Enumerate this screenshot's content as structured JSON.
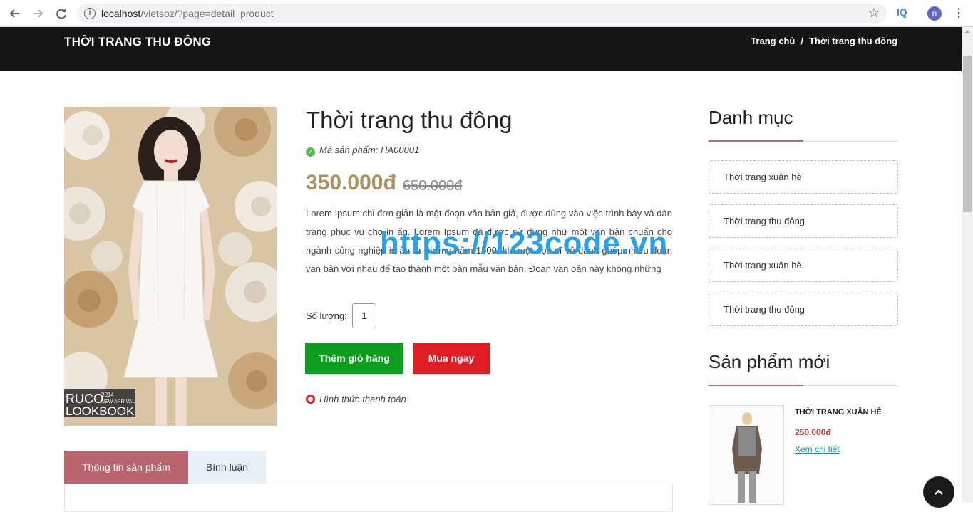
{
  "browser": {
    "url_host": "localhost",
    "url_path": "/vietsoz/?page=detail_product",
    "extension_label": "IQ",
    "profile_initial": "n"
  },
  "header": {
    "title": "THỜI TRANG THU ĐÔNG",
    "breadcrumb": [
      "Trang chủ",
      "/",
      "Thời trang thu đông"
    ]
  },
  "product": {
    "image_badge_line1": "RUCO",
    "image_badge_year": "2014",
    "image_badge_sub": "NEW ARRIVAL",
    "image_badge_line2": "LOOKBOOK",
    "title": "Thời trang thu đông",
    "sku": "Mã sản phẩm: HA00001",
    "price": "350.000đ",
    "old_price": "650.000đ",
    "description": "Lorem Ipsum chỉ đơn giản là một đoạn văn bản giả, được dùng vào việc trình bày và dàn trang phục vụ cho in ấn. Lorem Ipsum đã được sử dụng như một văn bản chuẩn cho ngành công nghiệp in ấn từ những năm 1500, khi một họa sĩ vô danh ghép nhiều đoạn văn bản với nhau để tạo thành một bản mẫu văn bản. Đoạn văn bản này không những",
    "quantity_label": "Số lượng:",
    "quantity_value": "1",
    "add_to_cart": "Thêm giỏ hàng",
    "buy_now": "Mua ngay",
    "payment_methods": "Hình thức thanh toán"
  },
  "watermark": "https://123code.vn",
  "tabs": [
    {
      "label": "Thông tin sản phẩm",
      "active": true
    },
    {
      "label": "Bình luận",
      "active": false
    }
  ],
  "sidebar": {
    "categories_heading": "Danh mục",
    "categories": [
      "Thời trang xuân hè",
      "Thời trang thu đông",
      "Thời trang xuân hè",
      "Thời trang thu đông"
    ],
    "new_products_heading": "Sản phẩm mới",
    "new_products": [
      {
        "name": "THỜI TRANG XUÂN HÈ",
        "price": "250.000đ",
        "link": "Xem chi tiết"
      }
    ]
  },
  "colors": {
    "accent": "#b96570",
    "price": "#b08f5c",
    "cart_button": "#0c9d1f",
    "buy_button": "#e01d25",
    "header_bg": "#151515"
  },
  "icons": {
    "sku": "check-circle-icon",
    "payment": "lifebuoy-icon",
    "back_to_top": "chevron-up-icon"
  }
}
